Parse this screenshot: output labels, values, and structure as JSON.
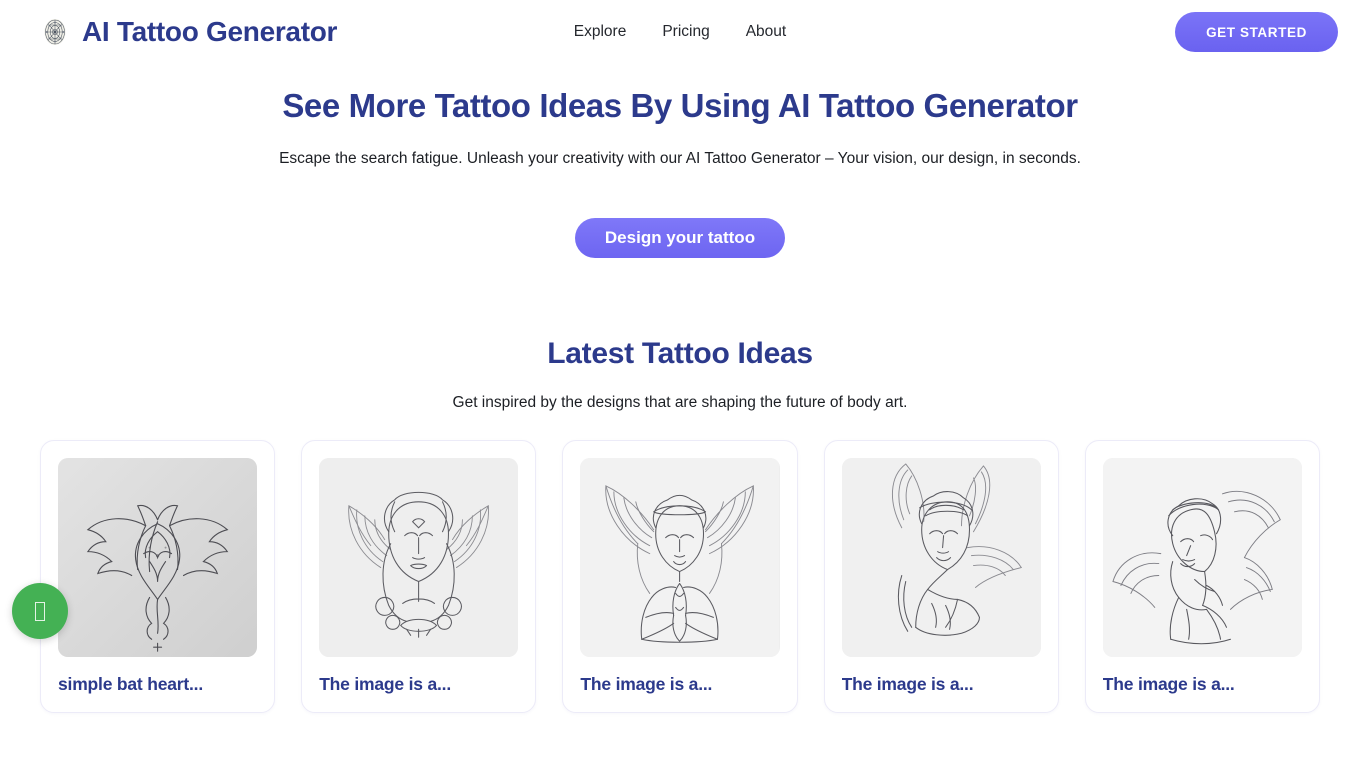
{
  "header": {
    "brand_name": "AI Tattoo Generator",
    "logo_icon": "mandala-icon",
    "nav": [
      {
        "label": "Explore"
      },
      {
        "label": "Pricing"
      },
      {
        "label": "About"
      }
    ],
    "get_started_label": "GET STARTED"
  },
  "hero": {
    "title": "See More Tattoo Ideas By Using AI Tattoo Generator",
    "subtitle": "Escape the search fatigue. Unleash your creativity with our AI Tattoo Generator – Your vision, our design, in seconds.",
    "cta_label": "Design your tattoo"
  },
  "latest": {
    "title": "Latest Tattoo Ideas",
    "subtitle": "Get inspired by the designs that are shaping the future of body art.",
    "cards": [
      {
        "title": "simple bat heart...",
        "image_alt": "ornate-bat-heart-sketch"
      },
      {
        "title": "The image is a...",
        "image_alt": "winged-woman-portrait-sketch"
      },
      {
        "title": "The image is a...",
        "image_alt": "praying-angel-sketch"
      },
      {
        "title": "The image is a...",
        "image_alt": "resting-angel-sketch"
      },
      {
        "title": "The image is a...",
        "image_alt": "sleeping-angel-sketch"
      }
    ]
  },
  "floating_widget": {
    "icon": "chat-widget-icon",
    "color": "#44b154",
    "glyph": ""
  },
  "colors": {
    "brand_navy": "#2c3a8c",
    "accent_purple": "#6d65f1",
    "card_border": "#ecebf8",
    "widget_green": "#44b154"
  }
}
